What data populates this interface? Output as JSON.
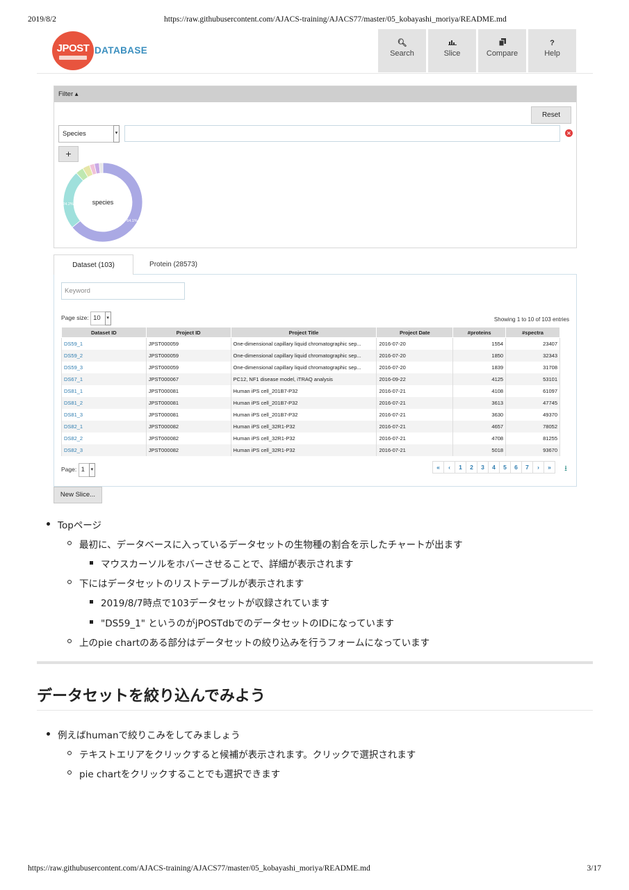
{
  "print_header": {
    "date": "2019/8/2",
    "url": "https://raw.githubusercontent.com/AJACS-training/AJACS77/master/05_kobayashi_moriya/README.md"
  },
  "print_footer": {
    "url": "https://raw.githubusercontent.com/AJACS-training/AJACS77/master/05_kobayashi_moriya/README.md",
    "page": "3/17"
  },
  "app": {
    "logo": "JPOST",
    "brand": "DATABASE",
    "nav": [
      {
        "icon": "search-icon",
        "label": "Search"
      },
      {
        "icon": "chart-icon",
        "label": "Slice"
      },
      {
        "icon": "copy-icon",
        "label": "Compare"
      },
      {
        "icon": "help-icon",
        "label": "Help"
      }
    ],
    "filter": {
      "header": "Filter ▴",
      "reset": "Reset",
      "field": "Species",
      "add": "+",
      "chart_label": "species",
      "slice_labels": [
        "24.2%",
        "64.1%"
      ]
    },
    "tabs": [
      "Dataset (103)",
      "Protein (28573)"
    ],
    "keyword_placeholder": "Keyword",
    "page_size_label": "Page size:",
    "page_size": "10",
    "showing": "Showing 1 to 10 of 103 entries",
    "columns": [
      "Dataset ID",
      "Project ID",
      "Project Title",
      "Project Date",
      "#proteins",
      "#spectra"
    ],
    "rows": [
      [
        "DS59_1",
        "JPST000059",
        "One-dimensional capillary liquid chromatographic sep...",
        "2016-07-20",
        "1554",
        "23407"
      ],
      [
        "DS59_2",
        "JPST000059",
        "One-dimensional capillary liquid chromatographic sep...",
        "2016-07-20",
        "1850",
        "32343"
      ],
      [
        "DS59_3",
        "JPST000059",
        "One-dimensional capillary liquid chromatographic sep...",
        "2016-07-20",
        "1839",
        "31708"
      ],
      [
        "DS67_1",
        "JPST000067",
        "PC12, NF1 disease model, iTRAQ analysis",
        "2016-09-22",
        "4125",
        "53101"
      ],
      [
        "DS81_1",
        "JPST000081",
        "Human iPS cell_201B7-P32",
        "2016-07-21",
        "4108",
        "61097"
      ],
      [
        "DS81_2",
        "JPST000081",
        "Human iPS cell_201B7-P32",
        "2016-07-21",
        "3613",
        "47745"
      ],
      [
        "DS81_3",
        "JPST000081",
        "Human iPS cell_201B7-P32",
        "2016-07-21",
        "3630",
        "49370"
      ],
      [
        "DS82_1",
        "JPST000082",
        "Human iPS cell_32R1-P32",
        "2016-07-21",
        "4657",
        "78052"
      ],
      [
        "DS82_2",
        "JPST000082",
        "Human iPS cell_32R1-P32",
        "2016-07-21",
        "4708",
        "81255"
      ],
      [
        "DS82_3",
        "JPST000082",
        "Human iPS cell_32R1-P32",
        "2016-07-21",
        "5018",
        "93670"
      ]
    ],
    "page_label": "Page:",
    "page": "1",
    "pager": [
      "«",
      "‹",
      "1",
      "2",
      "3",
      "4",
      "5",
      "6",
      "7",
      "›",
      "»"
    ],
    "new_slice": "New Slice..."
  },
  "doc": {
    "bullets": [
      {
        "level": 1,
        "text": "Topページ"
      },
      {
        "level": 2,
        "text": "最初に、データベースに入っているデータセットの生物種の割合を示したチャートが出ます"
      },
      {
        "level": 3,
        "text": "マウスカーソルをホバーさせることで、詳細が表示されます"
      },
      {
        "level": 2,
        "text": "下にはデータセットのリストテーブルが表示されます"
      },
      {
        "level": 3,
        "text": "2019/8/7時点で103データセットが収録されています"
      },
      {
        "level": 3,
        "text": "\"DS59_1\" というのがjPOSTdbでのデータセットのIDになっています"
      },
      {
        "level": 2,
        "text": "上のpie chartのある部分はデータセットの絞り込みを行うフォームになっています"
      }
    ],
    "heading": "データセットを絞り込んでみよう",
    "bullets2": [
      {
        "level": 1,
        "text": "例えばhumanで絞りこみをしてみましょう"
      },
      {
        "level": 2,
        "text": "テキストエリアをクリックすると候補が表示されます。クリックで選択されます"
      },
      {
        "level": 2,
        "text": "pie chartをクリックすることでも選択できます"
      }
    ]
  },
  "chart_data": {
    "type": "pie",
    "title": "species",
    "slices": [
      {
        "value": 64.1,
        "label": "64.1%",
        "color": "#aaa9e4"
      },
      {
        "value": 24.2,
        "label": "24.2%",
        "color": "#9fe0dc"
      },
      {
        "value": 3.2,
        "color": "#bfe8b0"
      },
      {
        "value": 3.0,
        "color": "#e6e6a8"
      },
      {
        "value": 2.0,
        "color": "#f0c2d8"
      },
      {
        "value": 2.0,
        "color": "#c9a9e6"
      },
      {
        "value": 1.5,
        "color": "#e8e8e8"
      }
    ]
  }
}
